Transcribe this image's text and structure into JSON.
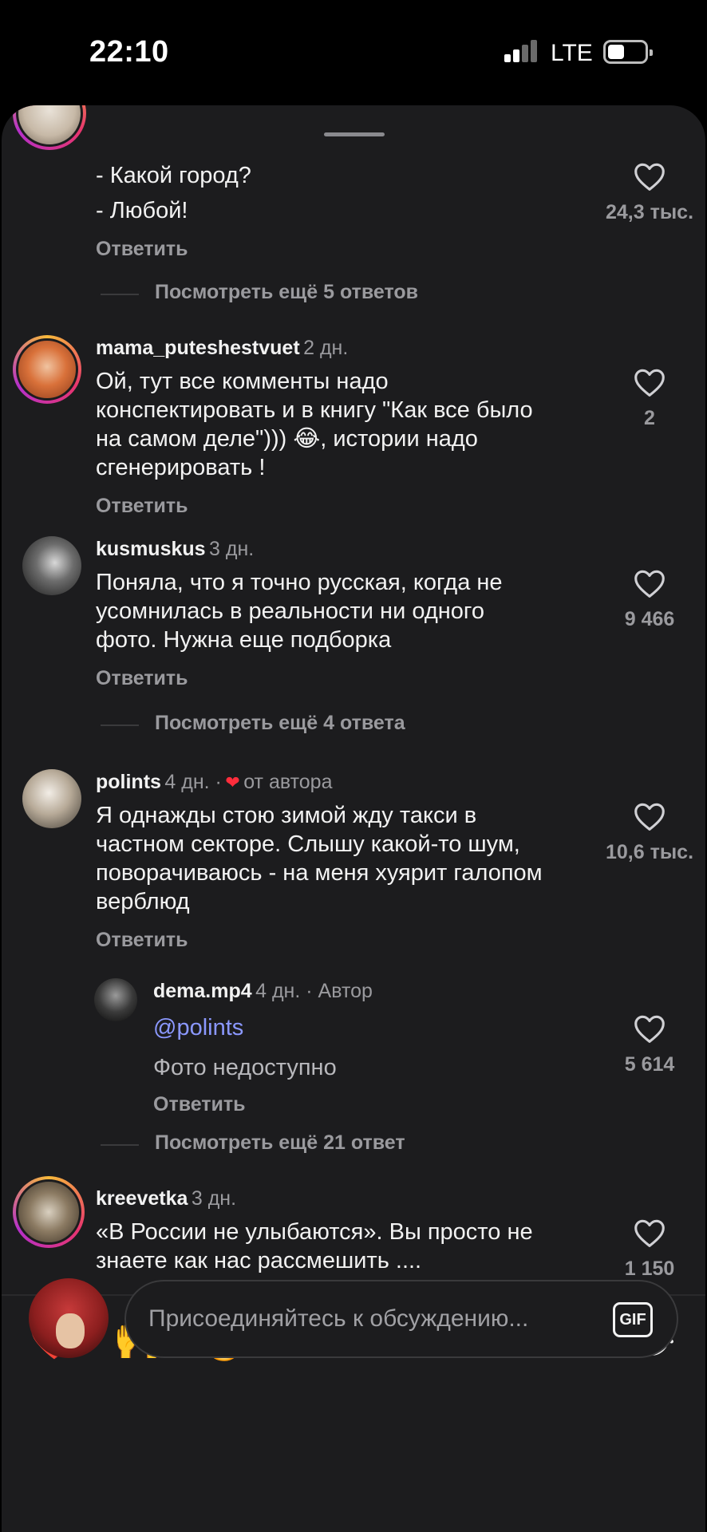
{
  "status_bar": {
    "time": "22:10",
    "network": "LTE",
    "battery_level": 0.45
  },
  "comments": [
    {
      "text_lines": [
        "- Какой город?",
        "- Любой!"
      ],
      "reply_label": "Ответить",
      "likes": "24,3 тыс.",
      "more_replies": "Посмотреть ещё 5 ответов"
    },
    {
      "username": "mama_puteshestvuet",
      "age": "2 дн.",
      "text_lines": [
        "Ой, тут все комменты надо",
        "конспектировать и в книгу \"Как все было",
        "на самом деле\"))) 😂, истории надо",
        "сгенерировать !"
      ],
      "reply_label": "Ответить",
      "likes": "2"
    },
    {
      "username": "kusmuskus",
      "age": "3 дн.",
      "text_lines": [
        "Поняла, что я точно русская, когда не",
        "усомнилась в реальности ни одного",
        "фото. Нужна еще подборка"
      ],
      "reply_label": "Ответить",
      "likes": "9 466",
      "more_replies": "Посмотреть ещё 4 ответа"
    },
    {
      "username": "polints",
      "age": "4 дн. ·",
      "author_like": "от автора",
      "text_lines": [
        "Я однажды стою зимой жду такси в",
        "частном секторе. Слышу какой-то шум,",
        "поворачиваюсь - на меня хуярит галопом",
        "верблюд"
      ],
      "reply_label": "Ответить",
      "likes": "10,6 тыс."
    },
    {
      "username": "dema.mp4",
      "age": "4 дн. · Автор",
      "mention": "@polints",
      "text_lines": [
        "Фото недоступно"
      ],
      "reply_label": "Ответить",
      "likes": "5 614",
      "more_replies": "Посмотреть ещё 21 ответ"
    },
    {
      "username": "kreevetka",
      "age": "3 дн.",
      "text_lines": [
        "«В России не улыбаются». Вы просто не",
        "знаете как нас рассмешить ...."
      ],
      "likes": "1 150"
    }
  ],
  "reactions": [
    "❤️",
    "🙌",
    "🔥",
    "👏",
    "😢",
    "😍",
    "😮",
    "😂"
  ],
  "composer": {
    "placeholder": "Присоединяйтесь к обсуждению...",
    "gif_label": "GIF"
  },
  "colors": {
    "background": "#1c1c1e",
    "mention": "#8b98ff",
    "author_heart": "#ff2d3c",
    "muted_text": "#9a9a9e"
  },
  "icons": {
    "like": "heart-outline-icon",
    "author_like": "heart-filled-icon",
    "attach_gif": "gif-icon"
  }
}
